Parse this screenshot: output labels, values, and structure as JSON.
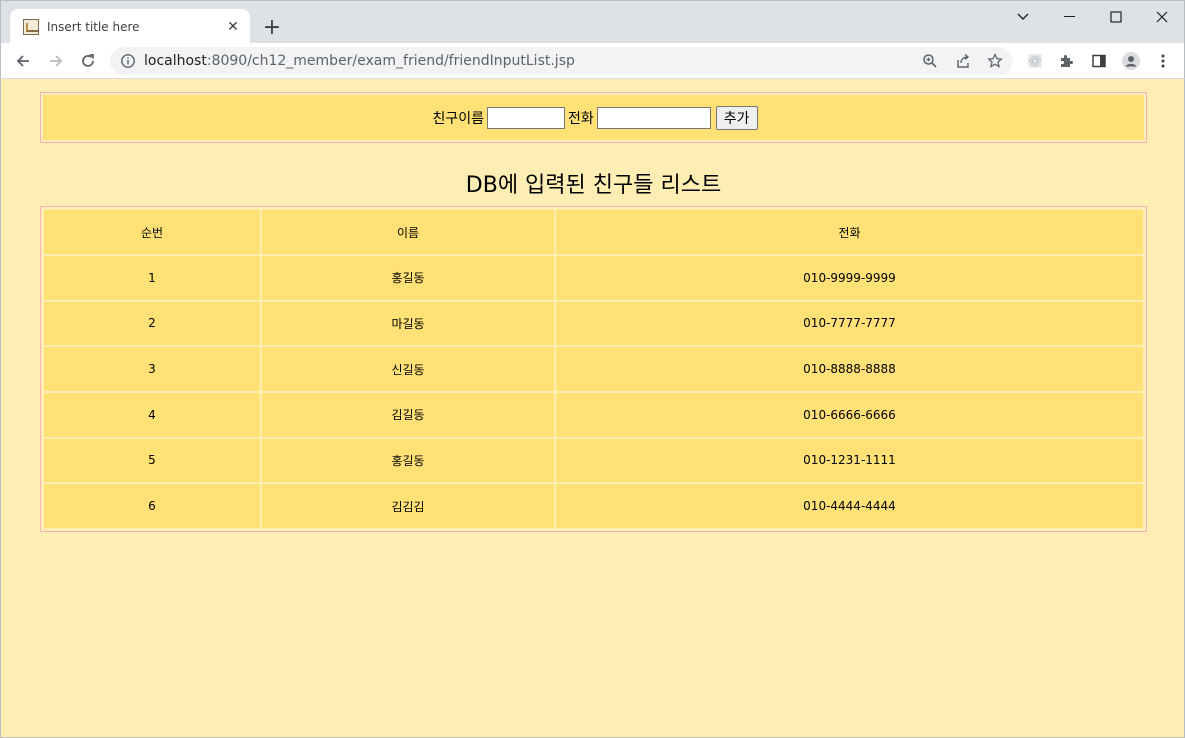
{
  "browser": {
    "tab_title": "Insert title here",
    "url_host": "localhost",
    "url_rest": ":8090/ch12_member/exam_friend/friendInputList.jsp"
  },
  "form": {
    "name_label": "친구이름",
    "name_value": "",
    "phone_label": "전화",
    "phone_value": "",
    "add_button": "추가"
  },
  "list": {
    "title": "DB에 입력된 친구들 리스트",
    "columns": [
      "순번",
      "이름",
      "전화"
    ],
    "rows": [
      {
        "no": "1",
        "name": "홍길동",
        "phone": "010-9999-9999"
      },
      {
        "no": "2",
        "name": "마길동",
        "phone": "010-7777-7777"
      },
      {
        "no": "3",
        "name": "신길동",
        "phone": "010-8888-8888"
      },
      {
        "no": "4",
        "name": "김길동",
        "phone": "010-6666-6666"
      },
      {
        "no": "5",
        "name": "홍길동",
        "phone": "010-1231-1111"
      },
      {
        "no": "6",
        "name": "김김김",
        "phone": "010-4444-4444"
      }
    ]
  },
  "colors": {
    "page_bg": "#ffeeb3",
    "cell_bg": "#ffe175",
    "border": "#f5b4b4"
  }
}
